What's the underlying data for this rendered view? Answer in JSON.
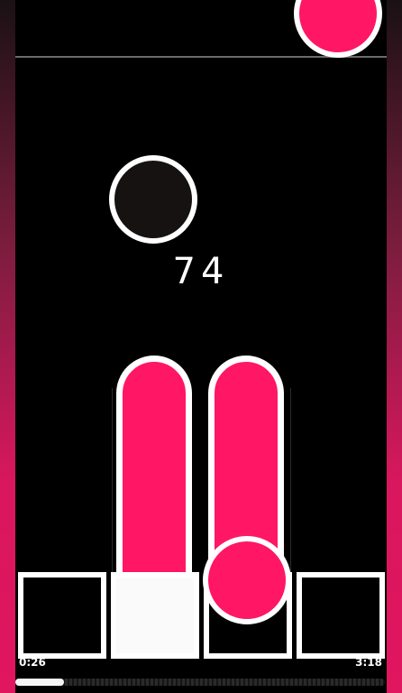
{
  "game": {
    "score": "74",
    "lane_count": 4,
    "active_pad_lane": 2,
    "colors": {
      "accent": "#ff1665",
      "pad_border": "#ffffff",
      "background": "#000000"
    }
  },
  "player": {
    "elapsed": "0:26",
    "total": "3:18",
    "progress_fraction": 0.131
  }
}
